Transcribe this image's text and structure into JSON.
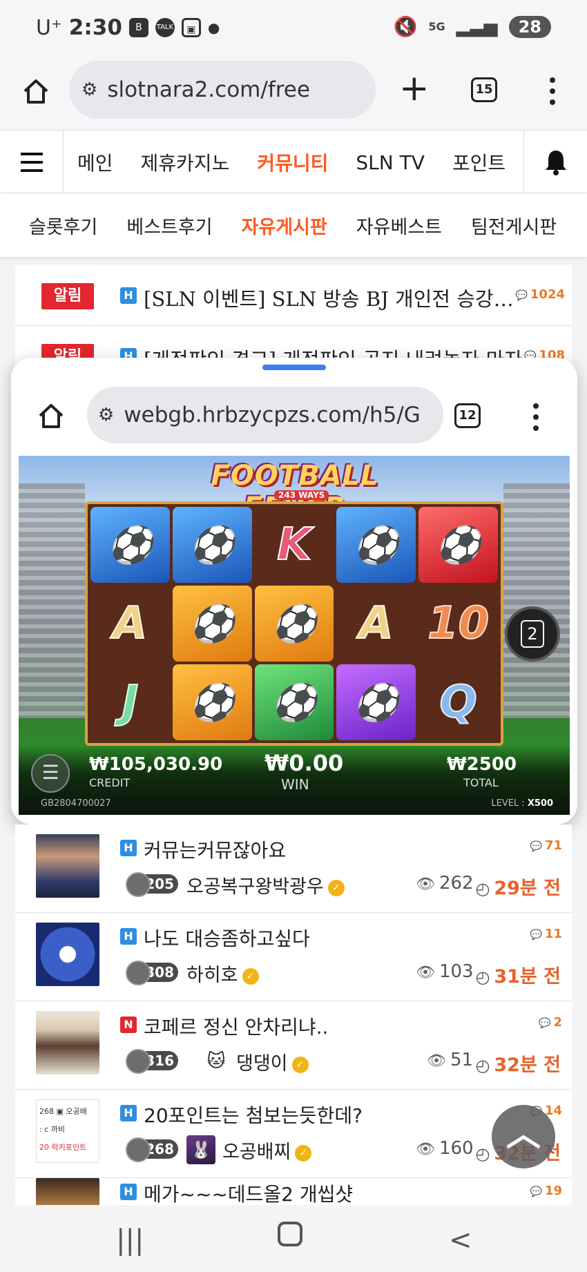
{
  "status_bar": {
    "carrier": "U⁺",
    "time": "2:30",
    "battery": "28",
    "network": "5G"
  },
  "browser": {
    "url": "slotnara2.com/free",
    "tab_count": "15"
  },
  "site_nav": {
    "items": [
      "메인",
      "제휴카지노",
      "커뮤니티",
      "SLN TV",
      "포인트"
    ],
    "active_index": 2
  },
  "sub_nav": {
    "items": [
      "슬롯후기",
      "베스트후기",
      "자유게시판",
      "자유베스트",
      "팀전게시판"
    ],
    "active_index": 2
  },
  "notices": [
    {
      "badge": "알림",
      "title": "[SLN 이벤트] SLN 방송 BJ 개인전 승강제 …",
      "comments": "1024"
    },
    {
      "badge": "알림",
      "title": "[게정판인 경고] 게정판인 공지 내려놓자 마자",
      "comments": "108"
    }
  ],
  "popup": {
    "url": "webgb.hrbzycpzs.com/h5/G",
    "tab_count": "12",
    "game": {
      "logo": "FOOTBALL FEVER",
      "ways": "243 WAYS",
      "credit_value": "₩105,030.90",
      "credit_label": "CREDIT",
      "win_value": "₩0.00",
      "win_label": "WIN",
      "total_value": "₩2500",
      "total_label": "TOTAL",
      "game_id": "GB2804700027",
      "level_label": "LEVEL :",
      "level_value": "X500",
      "spin_count": "2",
      "reels": [
        [
          "player-blue",
          "player-blue",
          "K",
          "player-blue",
          "player-red"
        ],
        [
          "A",
          "player-orange",
          "player-orange",
          "A",
          "10"
        ],
        [
          "J",
          "player-orange",
          "player-green",
          "player-purple",
          "Q"
        ]
      ]
    }
  },
  "posts": [
    {
      "badge": "H",
      "title": "커뮤는커뮤잖아요",
      "comments": "71",
      "level": "205",
      "author": "오공복구왕박광우",
      "views": "262",
      "time": "29분 전"
    },
    {
      "badge": "H",
      "title": "나도 대승좀하고싶다",
      "comments": "11",
      "level": "308",
      "author": "하히호",
      "views": "103",
      "time": "31분 전"
    },
    {
      "badge": "N",
      "title": "코페르 정신 안차리냐..",
      "comments": "2",
      "level": "316",
      "author": "댕댕이",
      "views": "51",
      "time": "32분 전"
    },
    {
      "badge": "H",
      "title": "20포인트는 첨보는듯한데?",
      "comments": "14",
      "level": "268",
      "author": "오공배찌",
      "views": "160",
      "time": "32분 전"
    },
    {
      "badge": "H",
      "title": "메가~~~데드올2 개씹샷",
      "comments": "19"
    }
  ],
  "colors": {
    "accent": "#ff5a1f",
    "notice_red": "#e3262f",
    "h_badge": "#2e8ee0",
    "time_orange": "#e8622a"
  }
}
